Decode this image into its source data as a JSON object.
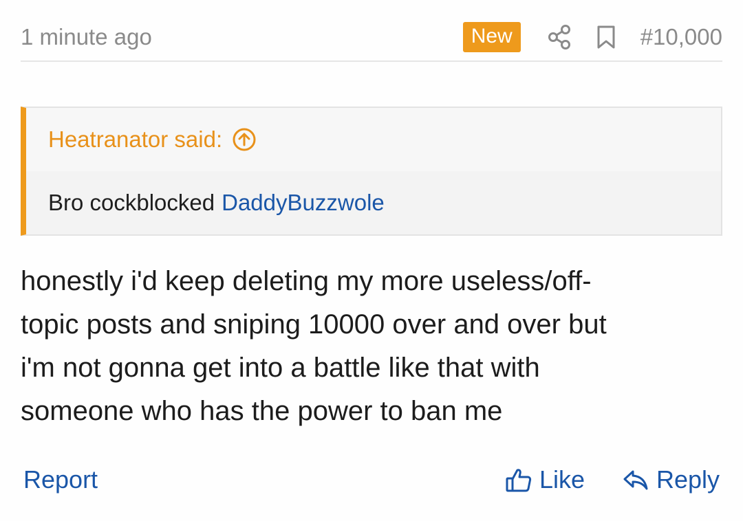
{
  "post": {
    "time": "1 minute ago",
    "badge": "New",
    "number": "#10,000"
  },
  "quote": {
    "author": "Heatranator said:",
    "text": "Bro cockblocked",
    "mention": "DaddyBuzzwole"
  },
  "body": {
    "lines": [
      "honestly i'd keep deleting my more useless/off-",
      "topic posts and sniping 10000 over and over but",
      "i'm not gonna get into a battle like that with",
      "someone who has the power to ban me"
    ]
  },
  "actions": {
    "report": "Report",
    "like": "Like",
    "reply": "Reply"
  },
  "icons": {
    "share": "share-icon",
    "bookmark": "bookmark-icon",
    "quote_jump": "arrow-up-circle-icon",
    "like": "thumbs-up-icon",
    "reply": "reply-icon"
  },
  "colors": {
    "accent": "#ee9a1c",
    "link": "#1a56a8",
    "muted": "#8a8a8a",
    "text": "#1c1c1c"
  }
}
